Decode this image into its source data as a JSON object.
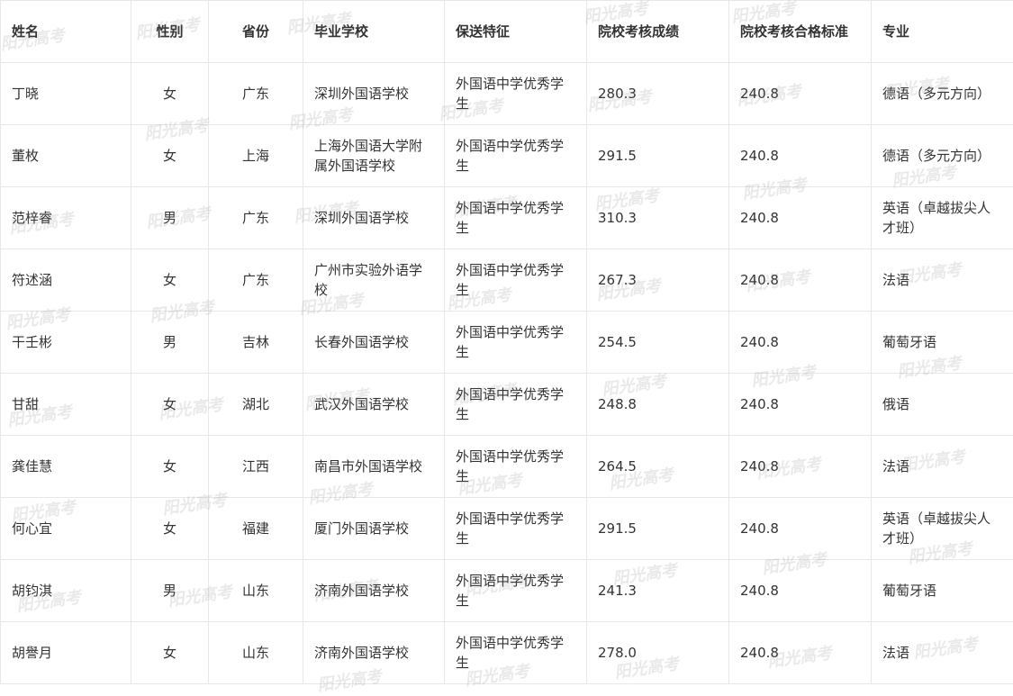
{
  "table": {
    "headers": [
      "姓名",
      "性别",
      "省份",
      "毕业学校",
      "保送特征",
      "院校考核成绩",
      "院校考核合格标准",
      "专业"
    ],
    "rows": [
      [
        "丁晓",
        "女",
        "广东",
        "深圳外国语学校",
        "外国语中学优秀学生",
        "280.3",
        "240.8",
        "德语（多元方向）"
      ],
      [
        "董枚",
        "女",
        "上海",
        "上海外国语大学附属外国语学校",
        "外国语中学优秀学生",
        "291.5",
        "240.8",
        "德语（多元方向）"
      ],
      [
        "范梓睿",
        "男",
        "广东",
        "深圳外国语学校",
        "外国语中学优秀学生",
        "310.3",
        "240.8",
        "英语（卓越拔尖人才班）"
      ],
      [
        "符述涵",
        "女",
        "广东",
        "广州市实验外语学校",
        "外国语中学优秀学生",
        "267.3",
        "240.8",
        "法语"
      ],
      [
        "干壬彬",
        "男",
        "吉林",
        "长春外国语学校",
        "外国语中学优秀学生",
        "254.5",
        "240.8",
        "葡萄牙语"
      ],
      [
        "甘甜",
        "女",
        "湖北",
        "武汉外国语学校",
        "外国语中学优秀学生",
        "248.8",
        "240.8",
        "俄语"
      ],
      [
        "龚佳慧",
        "女",
        "江西",
        "南昌市外国语学校",
        "外国语中学优秀学生",
        "264.5",
        "240.8",
        "法语"
      ],
      [
        "何心宜",
        "女",
        "福建",
        "厦门外国语学校",
        "外国语中学优秀学生",
        "291.5",
        "240.8",
        "英语（卓越拔尖人才班）"
      ],
      [
        "胡钧淇",
        "男",
        "山东",
        "济南外国语学校",
        "外国语中学优秀学生",
        "241.3",
        "240.8",
        "葡萄牙语"
      ],
      [
        "胡譽月",
        "女",
        "山东",
        "济南外国语学校",
        "外国语中学优秀学生",
        "278.0",
        "240.8",
        "法语"
      ]
    ]
  },
  "watermark": {
    "text": "阳光高考"
  }
}
